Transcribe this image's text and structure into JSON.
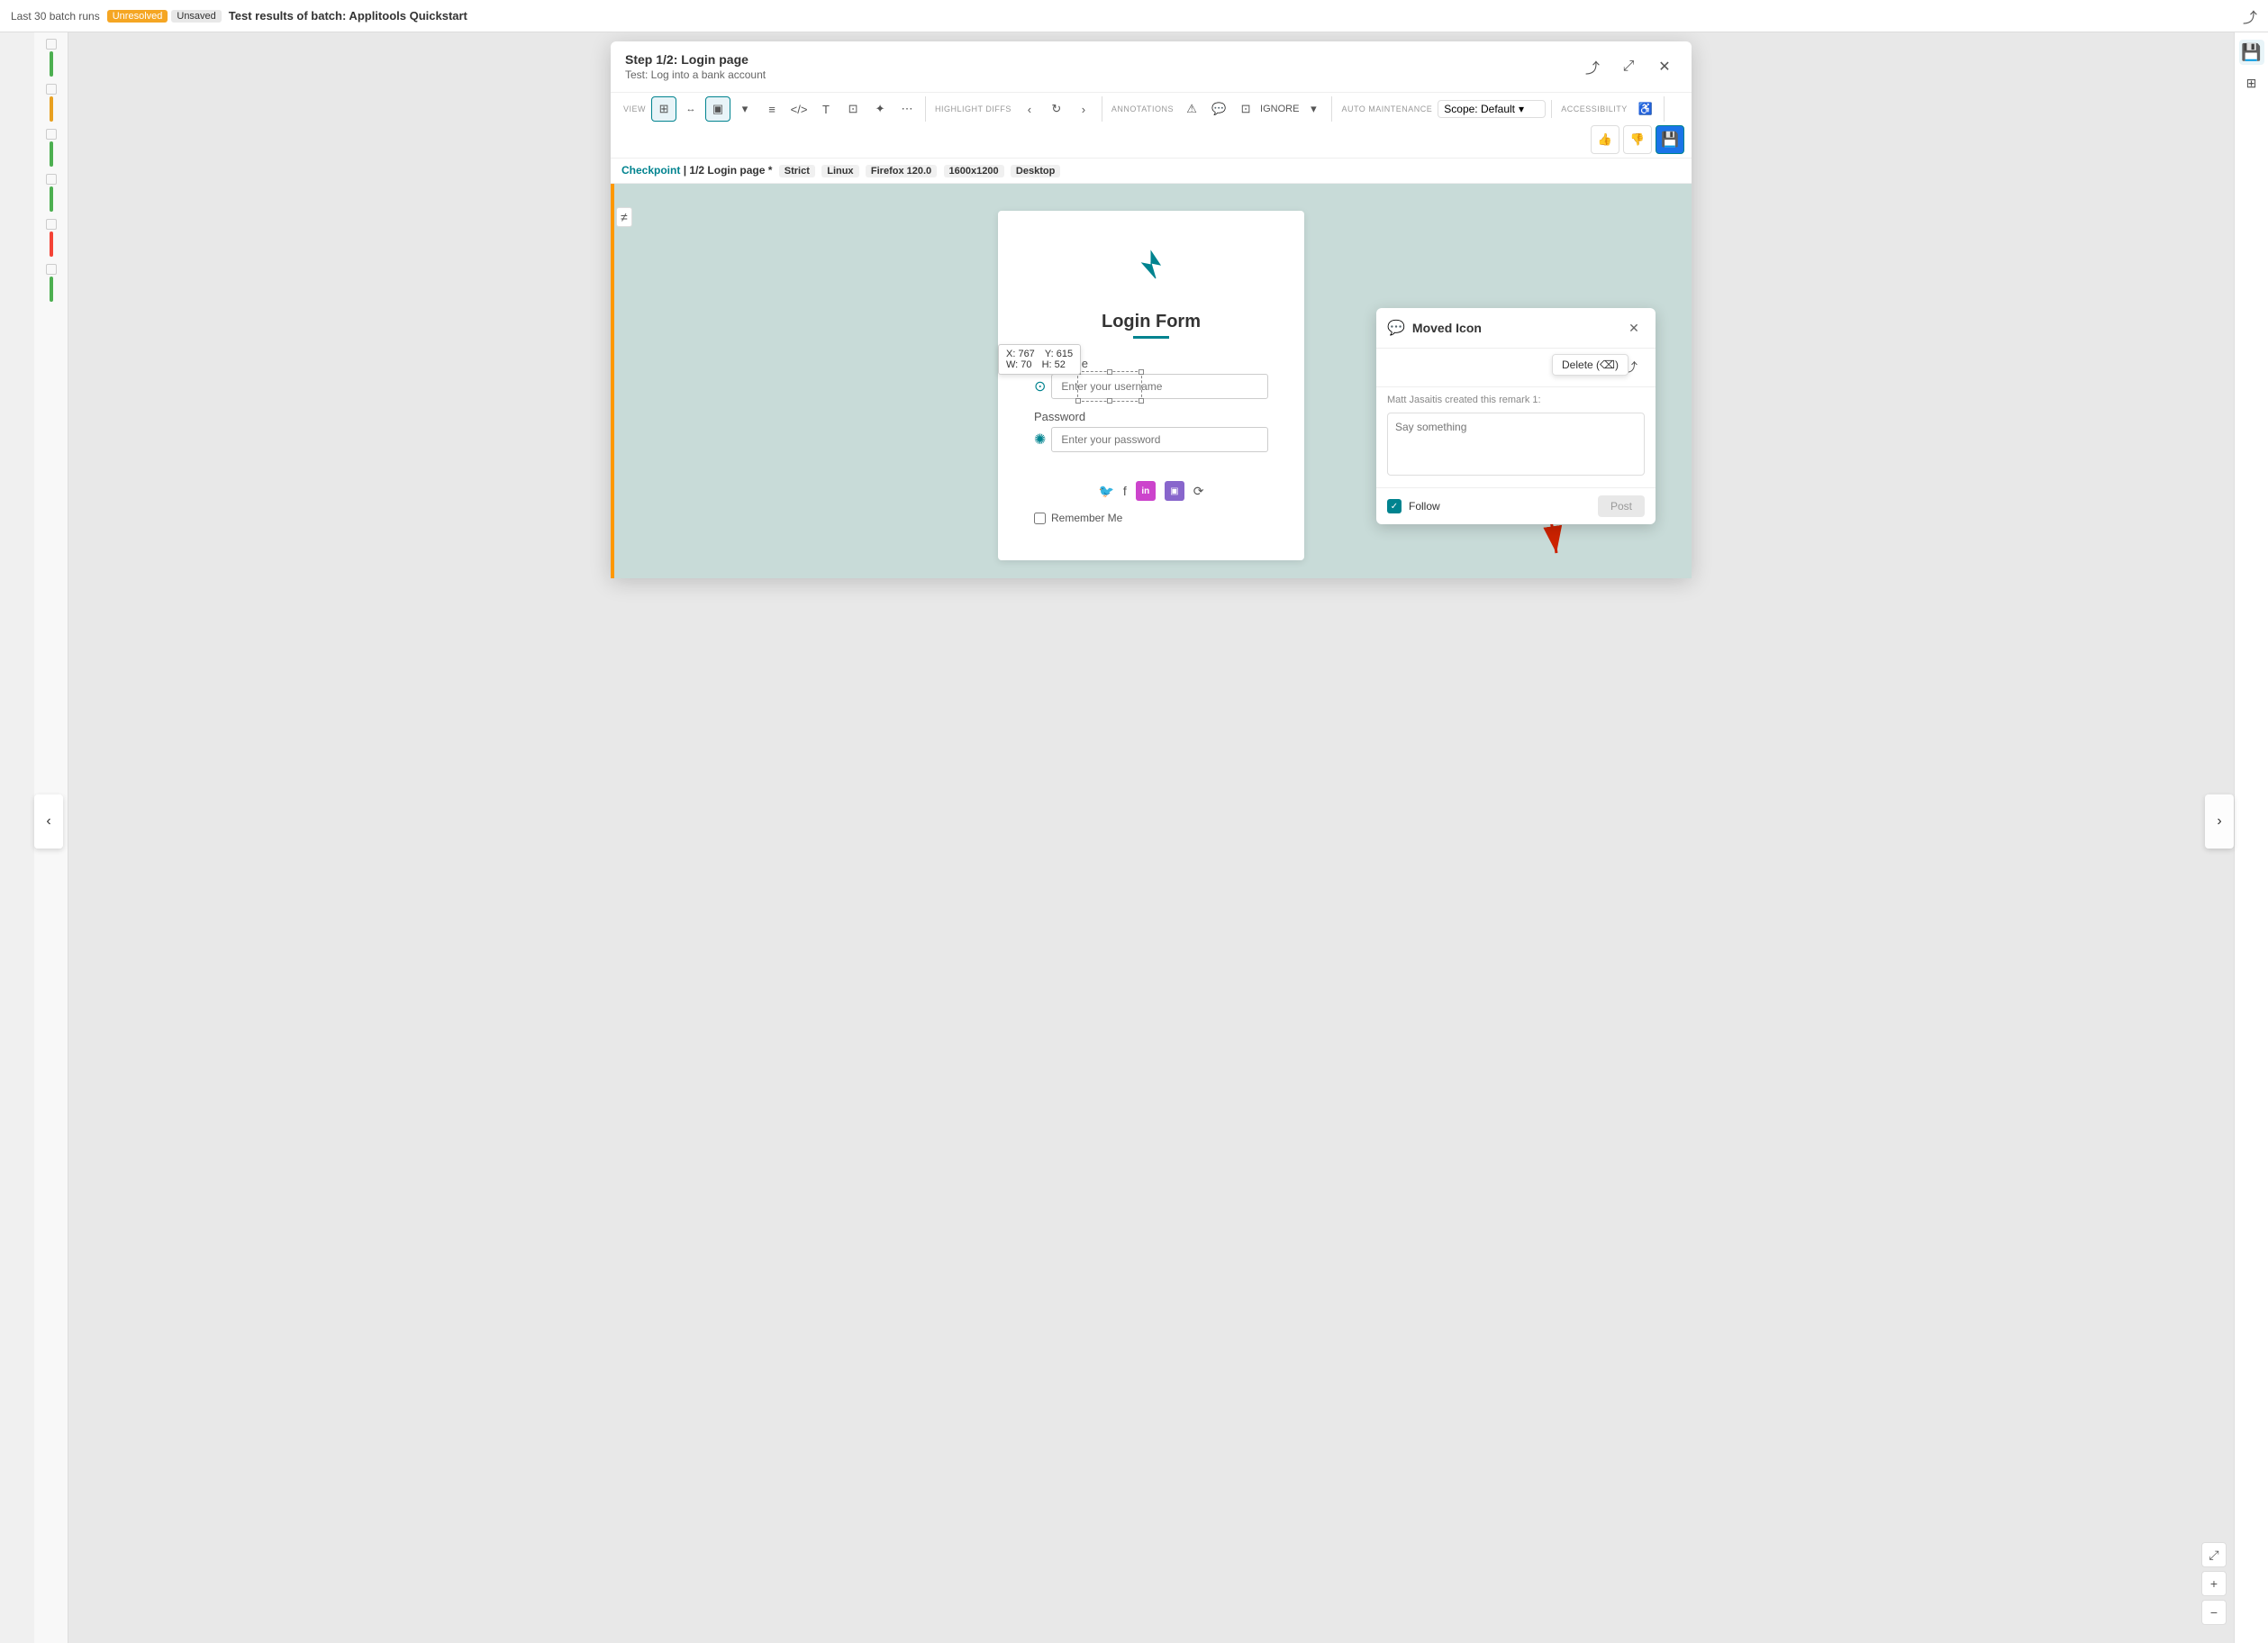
{
  "topbar": {
    "left_label": "Last 30 batch runs",
    "badge_unresolved": "Unresolved",
    "badge_unsaved": "Unsaved",
    "title": "Test results of batch: Applitools Quickstart",
    "share_icon": "⤴"
  },
  "dialog": {
    "title": "Step 1/2:  Login page",
    "subtitle": "Test: Log into a bank account",
    "share_icon": "⤴",
    "expand_icon": "⤢",
    "close_icon": "✕"
  },
  "toolbar": {
    "view_label": "VIEW",
    "highlight_label": "HIGHLIGHT DIFFS",
    "annotations_label": "ANNOTATIONS",
    "auto_maintenance_label": "AUTO MAINTENANCE",
    "accessibility_label": "ACCESSIBILITY",
    "ignore_label": "IGNORE",
    "scope_label": "Scope: Default",
    "prev_icon": "‹",
    "next_icon": "›",
    "more_icon": "⋯"
  },
  "checkpoint": {
    "label": "Checkpoint",
    "step": "1/2 Login page *",
    "tags": [
      "Strict",
      "Linux",
      "Firefox 120.0",
      "1600x1200",
      "Desktop"
    ]
  },
  "login_form": {
    "logo": "✦",
    "title": "Login Form",
    "username_label": "Username",
    "username_placeholder": "Enter your username",
    "password_label": "Password",
    "password_placeholder": "Enter your password",
    "remember_label": "Remember Me"
  },
  "coord_tooltip": {
    "x_label": "X: 767",
    "y_label": "Y: 615",
    "w_label": "W: 70",
    "h_label": "H: 52"
  },
  "remark": {
    "title": "Moved Icon",
    "close_icon": "✕",
    "delete_icon": "🗑",
    "share_icon": "⤴",
    "delete_tooltip": "Delete (⌫)",
    "meta": "Matt Jasaitis created this remark  1:",
    "placeholder": "Say something",
    "follow_label": "Follow",
    "post_label": "Post"
  },
  "nav": {
    "left_arrow": "‹",
    "right_arrow": "›"
  },
  "bottom_controls": {
    "expand": "⤢",
    "zoom_in": "+",
    "zoom_out": "−"
  },
  "colors": {
    "teal": "#00838f",
    "orange": "#ff9800",
    "green": "#4caf50",
    "red": "#f44336"
  }
}
